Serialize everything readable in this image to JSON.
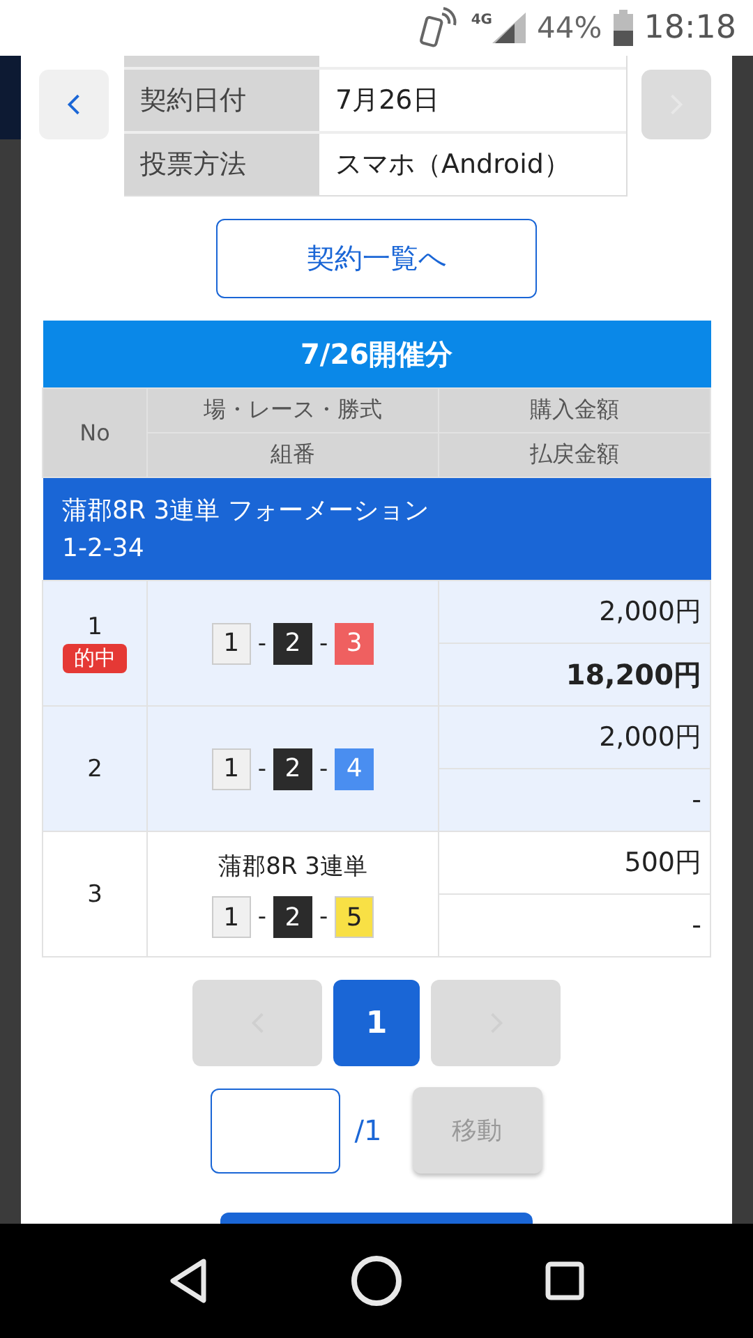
{
  "status_bar": {
    "network": "4G",
    "battery": "44%",
    "time": "18:18"
  },
  "nav": {
    "prev": {
      "disabled": false
    },
    "next": {
      "disabled": true
    }
  },
  "contract_info": [
    {
      "label": "契約日付",
      "value": "7月26日"
    },
    {
      "label": "投票方法",
      "value": "スマホ（Android）"
    }
  ],
  "list_button": "契約一覧へ",
  "table": {
    "title": "7/26開催分",
    "columns": {
      "no": "No",
      "race": "場・レース・勝式",
      "combo": "組番",
      "purchase": "購入金額",
      "payout": "払戻金額"
    },
    "group": {
      "title": "蒲郡8R 3連単 フォーメーション",
      "combo": "1-2-34"
    },
    "rows": [
      {
        "no": "1",
        "hit": true,
        "badge": "的中",
        "highlighted": true,
        "numbers": [
          {
            "text": "1",
            "color": "#f0f0f0"
          },
          {
            "sep": "-",
            "text": "2",
            "color": "#2b2b2b"
          },
          {
            "sep": "-",
            "text": "3",
            "color": "#ef6060"
          }
        ],
        "purchase": "2,000円",
        "payout": "18,200円"
      },
      {
        "no": "2",
        "hit": false,
        "highlighted": true,
        "numbers": [
          {
            "text": "1",
            "color": "#f0f0f0"
          },
          {
            "sep": "-",
            "text": "2",
            "color": "#2b2b2b"
          },
          {
            "sep": "-",
            "text": "4",
            "color": "#4a8ef0"
          }
        ],
        "purchase": "2,000円",
        "payout": "-"
      },
      {
        "no": "3",
        "hit": false,
        "highlighted": false,
        "race": "蒲郡8R 3連単",
        "numbers": [
          {
            "text": "1",
            "color": "#f0f0f0"
          },
          {
            "sep": "-",
            "text": "2",
            "color": "#2b2b2b"
          },
          {
            "sep": "-",
            "text": "5",
            "color": "#f8e045"
          }
        ],
        "purchase": "500円",
        "payout": "-"
      }
    ]
  },
  "pagination": {
    "prev": {
      "disabled": true
    },
    "pages": [
      {
        "label": "1",
        "selected": true
      }
    ],
    "next": {
      "disabled": true
    }
  },
  "jump": {
    "total": "/1",
    "button": "移動",
    "button_disabled": true
  }
}
